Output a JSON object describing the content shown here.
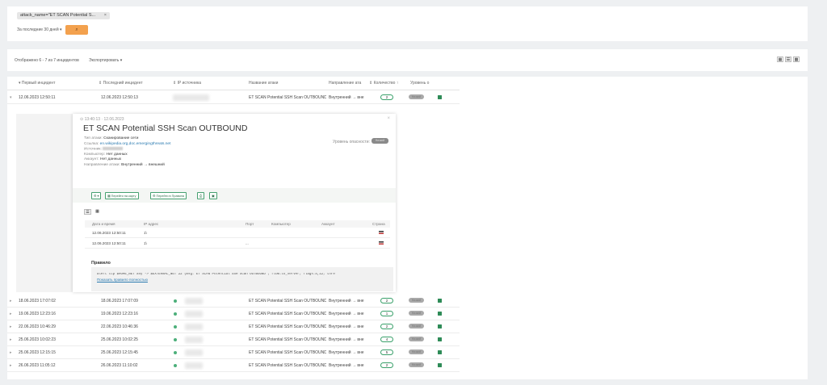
{
  "filter": {
    "chip_label": "attack_name=\"ET SCAN Potential S...",
    "chip_close": "×",
    "period_label": "За последние 30 дней",
    "period_chevron": "▾",
    "search_icon": "search-icon",
    "search_glyph": "⌕"
  },
  "results": {
    "shown_text": "Отображено 6 - 7 из 7 инцидентов",
    "export_label": "Экспортировать ▾",
    "view_icons": [
      "▦",
      "☰",
      "▩"
    ]
  },
  "table": {
    "headers": [
      "▾ Первый инцидент",
      "⇕ Последний инцидент",
      "⇕ IP источника",
      "Название атаки",
      "Направление ата",
      "⇕ Количество ↑",
      "Уровень о"
    ],
    "expanded_row": {
      "first": "12.06.2023 12:50:11",
      "last": "12.06.2023 12:50:13",
      "name": "ET SCAN Potential SSH Scan OUTBOUND",
      "direction": "Внутренний → вне",
      "count": "2",
      "level": "Низкий"
    },
    "rows": [
      {
        "first": "18.06.2023 17:07:02",
        "last": "18.06.2023 17:07:09",
        "name": "ET SCAN Potential SSH Scan OUTBOUND",
        "direction": "Внутренний → вне",
        "count": "2",
        "level": "Низкий"
      },
      {
        "first": "19.06.2023 12:23:16",
        "last": "19.06.2023 12:23:16",
        "name": "ET SCAN Potential SSH Scan OUTBOUND",
        "direction": "Внутренний → вне",
        "count": "1",
        "level": "Низкий"
      },
      {
        "first": "22.06.2023 10:46:29",
        "last": "22.06.2023 10:46:36",
        "name": "ET SCAN Potential SSH Scan OUTBOUND",
        "direction": "Внутренний → вне",
        "count": "2",
        "level": "Низкий"
      },
      {
        "first": "25.06.2023 10:02:23",
        "last": "25.06.2023 10:02:25",
        "name": "ET SCAN Potential SSH Scan OUTBOUND",
        "direction": "Внутренний → вне",
        "count": "4",
        "level": "Низкий"
      },
      {
        "first": "25.06.2023 12:15:15",
        "last": "25.06.2023 12:15:45",
        "name": "ET SCAN Potential SSH Scan OUTBOUND",
        "direction": "Внутренний → вне",
        "count": "5",
        "level": "Низкий"
      },
      {
        "first": "26.06.2023 11:05:12",
        "last": "26.06.2023 11:10:02",
        "name": "ET SCAN Potential SSH Scan OUTBOUND",
        "direction": "Внутренний → вне",
        "count": "2",
        "level": "Низкий"
      }
    ]
  },
  "detail": {
    "meta": "⊙ 13:40:13 · 12.06.2023",
    "close": "×",
    "title": "ET SCAN Potential SSH Scan OUTBOUND",
    "type_label": "Тип атаки:",
    "type_value": "Сканирование сети",
    "source_label": "Ссылка:",
    "source_value": "en.wikipedia.org,doc.emergingthreats.net",
    "network_label": "Источник:",
    "computer_label": "Компьютер:",
    "computer_value": "Нет данных",
    "account_label": "Аккаунт:",
    "account_value": "Нет данных",
    "direction_label": "Направление атаки:",
    "direction_value": "Внутренний → внешний",
    "severity_label": "Уровень опасности:",
    "severity_value": "Низкий",
    "toolbar": {
      "menu_button": "⚙ ▾",
      "map_button": "▦ Перейти на карту",
      "rules_button": "⚙ Перейти в Правила",
      "print_button": "⎙",
      "save_button": "▣"
    },
    "subtable": {
      "headers": [
        "Дата и время",
        "IP адрес",
        "Порт",
        "Компьютер",
        "Аккаунт",
        "Страна"
      ],
      "rows": [
        {
          "datetime": "12.06.2023 12:50:11",
          "ip": "1\\",
          "port": ""
        },
        {
          "datetime": "12.06.2023 12:50:11",
          "ip": "1\\",
          "port": "..."
        }
      ]
    },
    "rule_title": "Правило",
    "rule_code": "alert tcp $HOME_NET any -> $EXTERNAL_NET 22 (msg:\"ET SCAN Potential SSH Scan OUTBOUND\"; flow:to_server; flags:S,12; thre",
    "rule_link": "Показать правило полностью"
  },
  "colors": {
    "accent_orange": "#f3a14e",
    "accent_green": "#3aa06a",
    "background": "#eef0f2"
  }
}
